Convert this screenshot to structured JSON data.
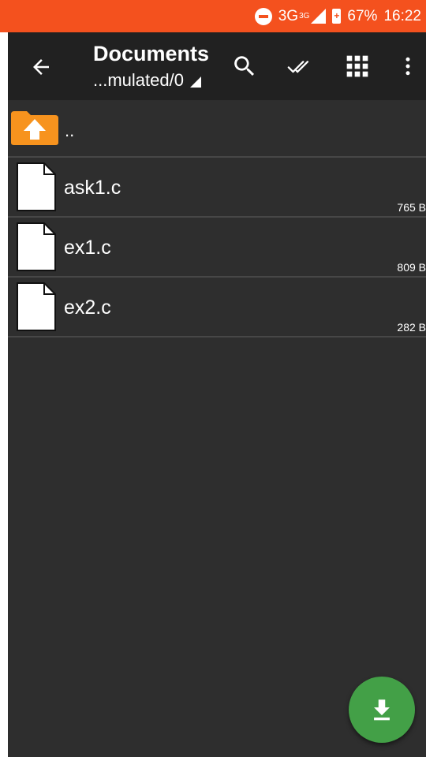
{
  "status_bar": {
    "network": "3G",
    "network_sup": "3G",
    "battery": "67%",
    "time": "16:22"
  },
  "app_bar": {
    "title": "Documents",
    "path": "...mulated/0"
  },
  "parent_dir_label": "..",
  "files": [
    {
      "name": "ask1.c",
      "size": "765 B"
    },
    {
      "name": "ex1.c",
      "size": "809 B"
    },
    {
      "name": "ex2.c",
      "size": "282 B"
    }
  ],
  "colors": {
    "status_bar": "#f4511e",
    "app_bar": "#212121",
    "background": "#2e2e2e",
    "fab": "#43a047",
    "folder": "#f7931e"
  },
  "icons": {
    "back": "arrow-back-icon",
    "search": "search-icon",
    "select": "double-check-icon",
    "grid": "grid-view-icon",
    "more": "more-vert-icon",
    "fab": "download-icon"
  }
}
